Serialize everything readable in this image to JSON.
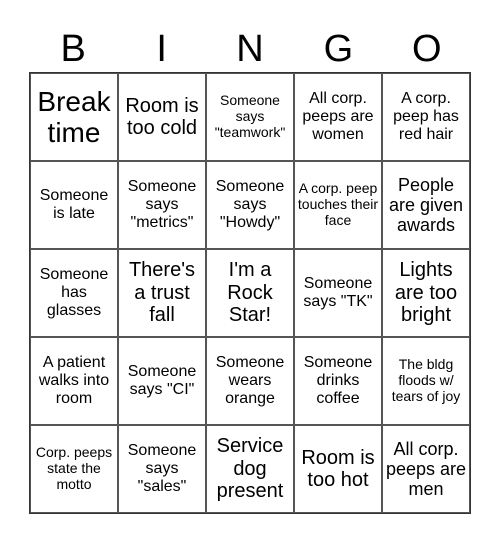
{
  "header": [
    "B",
    "I",
    "N",
    "G",
    "O"
  ],
  "cells": [
    "Break time",
    "Room is too cold",
    "Someone says \"teamwork\"",
    "All corp. peeps are women",
    "A corp. peep has red hair",
    "Someone is late",
    "Someone says \"metrics\"",
    "Someone says \"Howdy\"",
    "A corp. peep touches their face",
    "People are given awards",
    "Someone has glasses",
    "There's a trust fall",
    "I'm a Rock Star!",
    "Someone says \"TK\"",
    "Lights are too bright",
    "A patient walks into room",
    "Someone says \"CI\"",
    "Someone wears orange",
    "Someone drinks coffee",
    "The bldg floods w/ tears of joy",
    "Corp. peeps state the motto",
    "Someone says \"sales\"",
    "Service dog present",
    "Room is too hot",
    "All corp. peeps are men"
  ]
}
